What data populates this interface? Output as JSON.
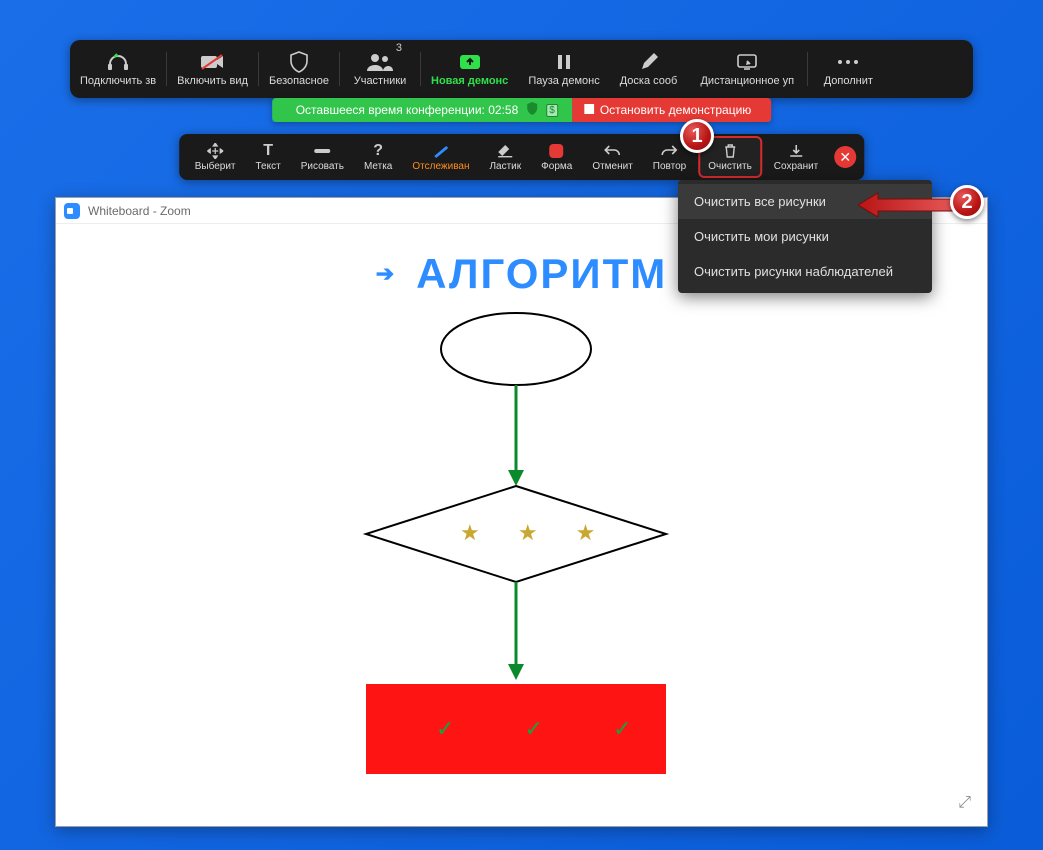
{
  "main_toolbar": {
    "audio": "Подключить зв",
    "video": "Включить вид",
    "security": "Безопасное",
    "participants": "Участники",
    "participants_count": "3",
    "new_share": "Новая демонс",
    "pause": "Пауза демонс",
    "whiteboard": "Доска сооб",
    "remote": "Дистанционное уп",
    "more": "Дополнит"
  },
  "status": {
    "time_label": "Оставшееся время конференции: 02:58",
    "stop": "Остановить демонстрацию"
  },
  "anno": {
    "select": "Выберит",
    "text": "Текст",
    "draw": "Рисовать",
    "stamp": "Метка",
    "spotlight": "Отслеживан",
    "eraser": "Ластик",
    "format": "Форма",
    "undo": "Отменит",
    "redo": "Повтор",
    "clear": "Очистить",
    "save": "Сохранит"
  },
  "dropdown": {
    "all": "Очистить все рисунки",
    "mine": "Очистить мои рисунки",
    "viewers": "Очистить рисунки наблюдателей"
  },
  "steps": {
    "one": "1",
    "two": "2"
  },
  "whiteboard": {
    "title": "Whiteboard - Zoom",
    "drawing_title": "АЛГОРИТМ"
  }
}
